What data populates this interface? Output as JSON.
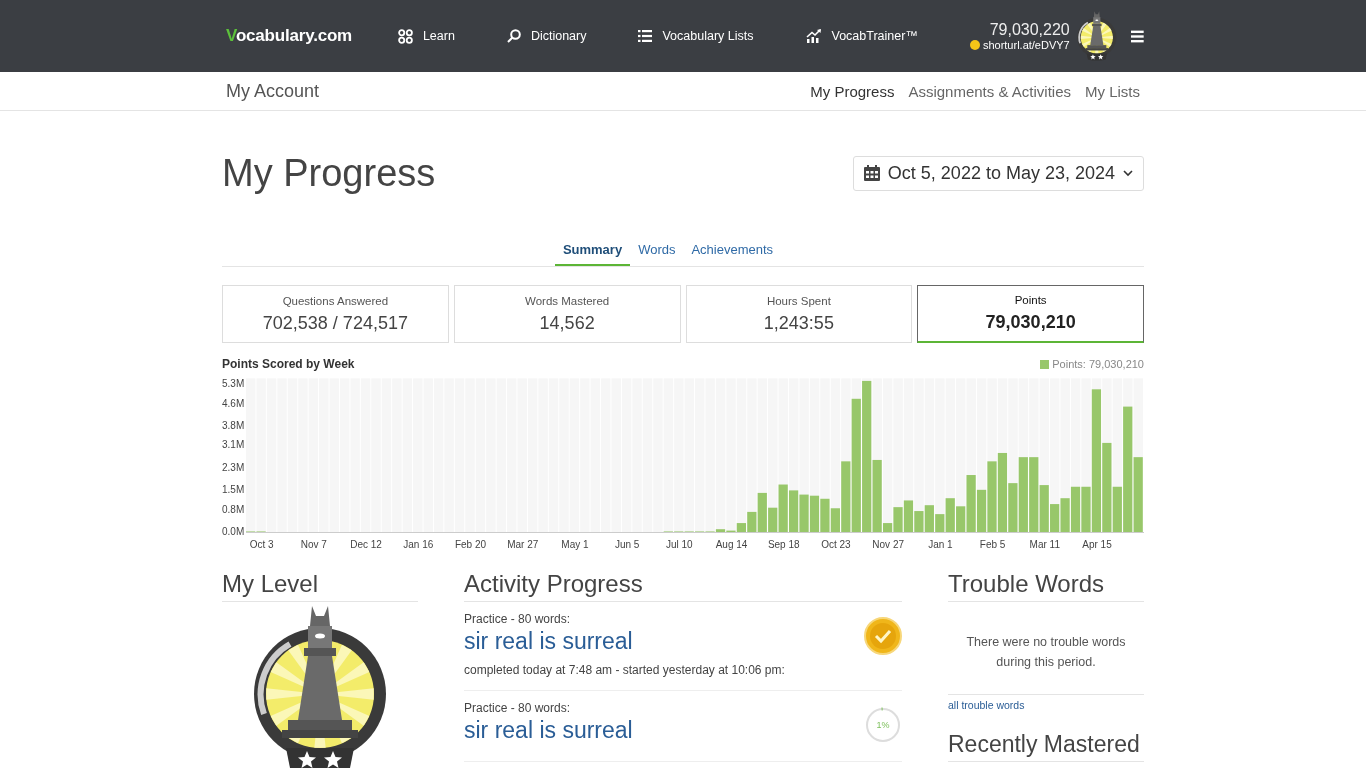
{
  "header": {
    "logo": "Vocabulary.com",
    "nav": [
      {
        "label": "Learn"
      },
      {
        "label": "Dictionary"
      },
      {
        "label": "Vocabulary Lists"
      },
      {
        "label": "VocabTrainer™"
      }
    ],
    "user": {
      "points": "79,030,220",
      "name": "shorturl.at/eDVY7"
    }
  },
  "subnav": {
    "title": "My Account",
    "links": [
      {
        "label": "My Progress",
        "selected": true
      },
      {
        "label": "Assignments & Activities",
        "selected": false
      },
      {
        "label": "My Lists",
        "selected": false
      }
    ]
  },
  "page_title": "My Progress",
  "date_range": "Oct 5, 2022 to May 23, 2024",
  "tabs": [
    {
      "label": "Summary",
      "selected": true
    },
    {
      "label": "Words",
      "selected": false
    },
    {
      "label": "Achievements",
      "selected": false
    }
  ],
  "stats": [
    {
      "label": "Questions Answered",
      "value": "702,538 / 724,517",
      "selected": false
    },
    {
      "label": "Words Mastered",
      "value": "14,562",
      "selected": false
    },
    {
      "label": "Hours Spent",
      "value": "1,243:55",
      "selected": false
    },
    {
      "label": "Points",
      "value": "79,030,210",
      "selected": true
    }
  ],
  "chart_data": {
    "type": "bar",
    "title": "Points Scored by Week",
    "categories": [
      null,
      "Oct 3",
      null,
      null,
      null,
      null,
      "Nov 7",
      null,
      null,
      null,
      null,
      "Dec 12",
      null,
      null,
      null,
      null,
      "Jan 16",
      null,
      null,
      null,
      null,
      "Feb 20",
      null,
      null,
      null,
      null,
      "Mar 27",
      null,
      null,
      null,
      null,
      "May 1",
      null,
      null,
      null,
      null,
      "Jun 5",
      null,
      null,
      null,
      null,
      "Jul 10",
      null,
      null,
      null,
      null,
      "Aug 14",
      null,
      null,
      null,
      null,
      "Sep 18",
      null,
      null,
      null,
      null,
      "Oct 23",
      null,
      null,
      null,
      null,
      "Nov 27",
      null,
      null,
      null,
      null,
      "Jan 1",
      null,
      null,
      null,
      null,
      "Feb 5",
      null,
      null,
      null,
      null,
      "Mar 11",
      null,
      null,
      null,
      null,
      "Apr 15",
      null,
      null,
      null,
      null
    ],
    "series": [
      {
        "name": "Points: 79,030,210",
        "color": "#98c76a",
        "values": [
          0.02,
          0.02,
          0,
          0,
          0,
          0,
          0,
          0,
          0,
          0,
          0,
          0,
          0,
          0,
          0,
          0,
          0,
          0,
          0,
          0,
          0,
          0,
          0,
          0,
          0,
          0,
          0,
          0,
          0,
          0,
          0,
          0,
          0,
          0,
          0,
          0,
          0,
          0,
          0,
          0,
          0.02,
          0.02,
          0.02,
          0.02,
          0.02,
          0.1,
          0.05,
          0.32,
          0.72,
          1.4,
          0.87,
          1.7,
          1.49,
          1.34,
          1.3,
          1.19,
          0.85,
          2.53,
          4.77,
          5.41,
          2.58,
          0.32,
          0.89,
          1.13,
          0.75,
          0.96,
          0.64,
          1.21,
          0.92,
          2.04,
          1.51,
          2.53,
          2.83,
          1.75,
          2.68,
          2.68,
          1.68,
          1.0,
          1.21,
          1.62,
          1.62,
          5.11,
          3.19,
          1.62,
          4.49,
          2.68
        ]
      }
    ],
    "ylim": [
      0,
      5.5
    ],
    "yticks": [
      {
        "value": 0,
        "label": "0.0M"
      },
      {
        "value": 0.8,
        "label": "0.8M"
      },
      {
        "value": 1.5,
        "label": "1.5M"
      },
      {
        "value": 2.3,
        "label": "2.3M"
      },
      {
        "value": 3.1,
        "label": "3.1M"
      },
      {
        "value": 3.8,
        "label": "3.8M"
      },
      {
        "value": 4.6,
        "label": "4.6M"
      },
      {
        "value": 5.3,
        "label": "5.3M"
      }
    ]
  },
  "level": {
    "title": "My Level"
  },
  "activity": {
    "title": "Activity Progress",
    "items": [
      {
        "heading": "Practice - 80 words:",
        "title": "sir real is surreal",
        "detail": "completed today at 7:48 am - started yesterday at 10:06 pm:",
        "kind": "complete"
      },
      {
        "heading": "Practice - 80 words:",
        "title": "sir real is surreal",
        "kind": "progress",
        "progress_label": "1%",
        "level": 0.01
      }
    ]
  },
  "trouble": {
    "title": "Trouble Words",
    "message": "There were no trouble words during this period.",
    "link": "all trouble words"
  },
  "mastered": {
    "title": "Recently Mastered"
  }
}
